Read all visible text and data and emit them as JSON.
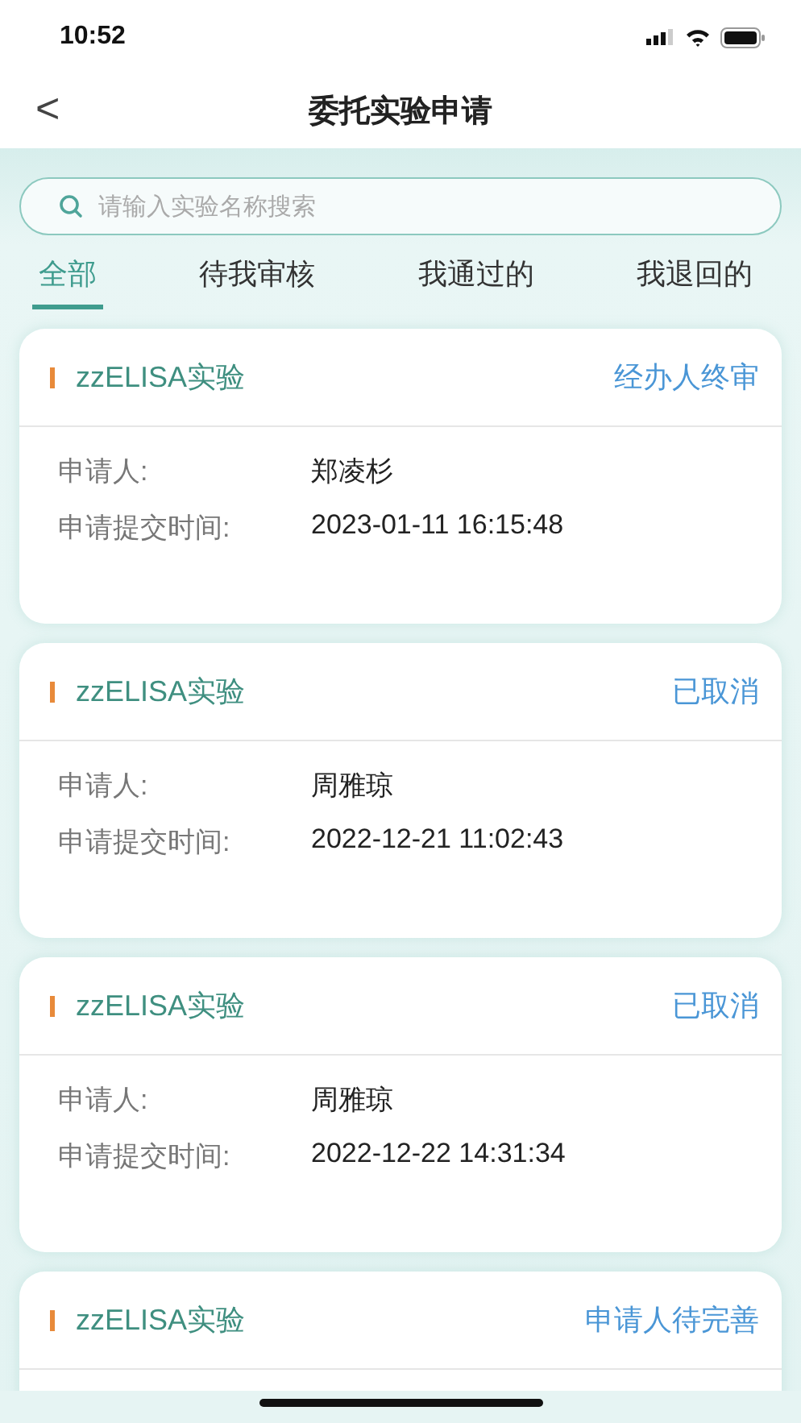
{
  "status_bar": {
    "time": "10:52"
  },
  "header": {
    "back": "<",
    "title": "委托实验申请"
  },
  "search": {
    "placeholder": "请输入实验名称搜索"
  },
  "tabs": [
    {
      "label": "全部",
      "selected": true
    },
    {
      "label": "待我审核",
      "selected": false
    },
    {
      "label": "我通过的",
      "selected": false
    },
    {
      "label": "我退回的",
      "selected": false
    }
  ],
  "cards": [
    {
      "title": "zzELISA实验",
      "status": "经办人终审",
      "rows": [
        {
          "label": "申请人:",
          "value": "郑凌杉"
        },
        {
          "label": "申请提交时间:",
          "value": "2023-01-11 16:15:48"
        }
      ]
    },
    {
      "title": "zzELISA实验",
      "status": "已取消",
      "rows": [
        {
          "label": "申请人:",
          "value": "周雅琼"
        },
        {
          "label": "申请提交时间:",
          "value": "2022-12-21 11:02:43"
        }
      ]
    },
    {
      "title": "zzELISA实验",
      "status": "已取消",
      "rows": [
        {
          "label": "申请人:",
          "value": "周雅琼"
        },
        {
          "label": "申请提交时间:",
          "value": "2022-12-22 14:31:34"
        }
      ]
    },
    {
      "title": "zzELISA实验",
      "status": "申请人待完善"
    }
  ]
}
